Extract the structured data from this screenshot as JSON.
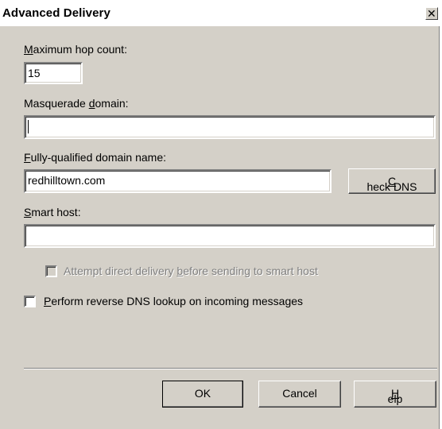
{
  "window": {
    "title": "Advanced Delivery",
    "close_glyph": "✕"
  },
  "fields": {
    "max_hop": {
      "label_pre": "",
      "label_key": "M",
      "label_post": "aximum hop count:",
      "value": "15"
    },
    "masquerade": {
      "label_pre": "Masquerade ",
      "label_key": "d",
      "label_post": "omain:",
      "value": ""
    },
    "fqdn": {
      "label_pre": "",
      "label_key": "F",
      "label_post": "ully-qualified domain name:",
      "value": "redhilltown.com"
    },
    "smart_host": {
      "label_pre": "",
      "label_key": "S",
      "label_post": "mart host:",
      "value": ""
    }
  },
  "check_dns": {
    "label_pre": "",
    "label_key": "C",
    "label_post": "heck DNS"
  },
  "options": {
    "attempt_direct": {
      "label_pre": "Attempt direct delivery ",
      "label_key": "b",
      "label_post": "efore sending to smart host",
      "checked": false,
      "enabled": false
    },
    "reverse_dns": {
      "label_pre": "",
      "label_key": "P",
      "label_post": "erform reverse DNS lookup on incoming messages",
      "checked": false,
      "enabled": true
    }
  },
  "buttons": {
    "ok": "OK",
    "cancel": "Cancel",
    "help": {
      "label_pre": "",
      "label_key": "H",
      "label_post": "elp"
    }
  }
}
